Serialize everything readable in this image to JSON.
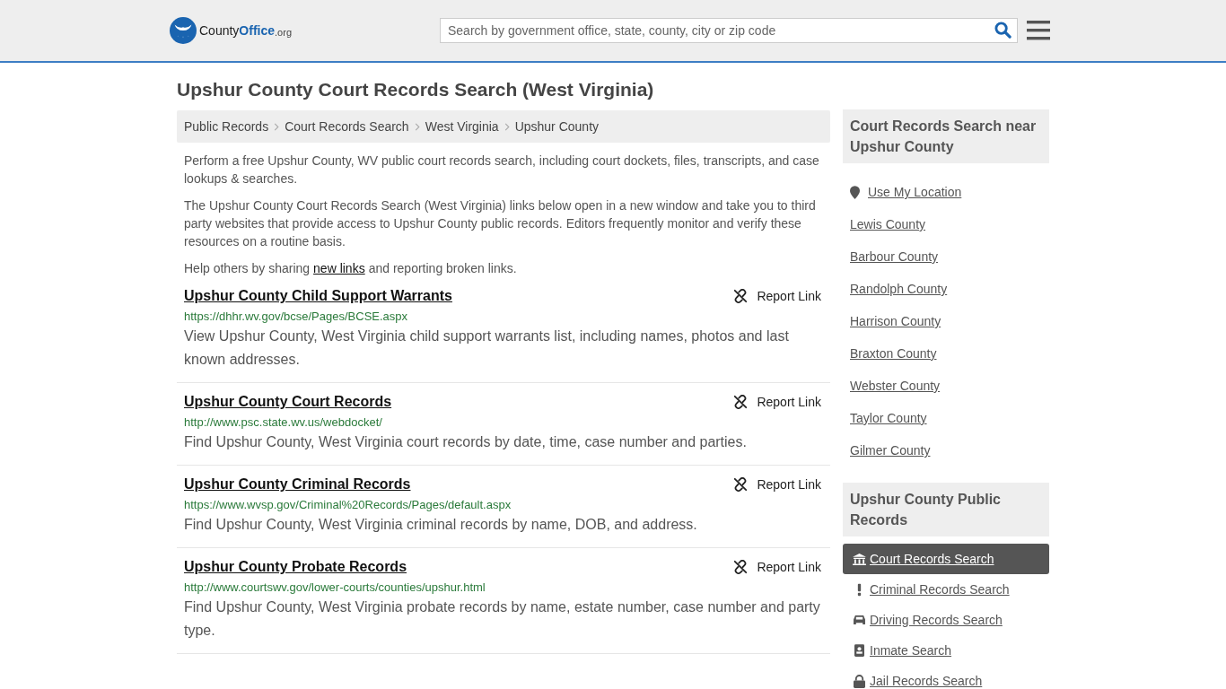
{
  "header": {
    "logo": {
      "name": "County",
      "brand": "Office",
      "suffix": ".org"
    },
    "search": {
      "placeholder": "Search by government office, state, county, city or zip code"
    }
  },
  "page_title": "Upshur County Court Records Search (West Virginia)",
  "breadcrumbs": [
    "Public Records",
    "Court Records Search",
    "West Virginia",
    "Upshur County"
  ],
  "intro": [
    "Perform a free Upshur County, WV public court records search, including court dockets, files, transcripts, and case lookups & searches.",
    "The Upshur County Court Records Search (West Virginia) links below open in a new window and take you to third party websites that provide access to Upshur County public records. Editors frequently monitor and verify these resources on a routine basis."
  ],
  "share_note": {
    "before": "Help others by sharing",
    "link": "new links",
    "after": "and reporting broken links."
  },
  "links": [
    {
      "title": "Upshur County Child Support Warrants",
      "url": "https://dhhr.wv.gov/bcse/Pages/BCSE.aspx",
      "description": "View Upshur County, West Virginia child support warrants list, including names, photos and last known addresses.",
      "report": "Report Link"
    },
    {
      "title": "Upshur County Court Records",
      "url": "http://www.psc.state.wv.us/webdocket/",
      "description": "Find Upshur County, West Virginia court records by date, time, case number and parties.",
      "report": "Report Link"
    },
    {
      "title": "Upshur County Criminal Records",
      "url": "https://www.wvsp.gov/Criminal%20Records/Pages/default.aspx",
      "description": "Find Upshur County, West Virginia criminal records by name, DOB, and address.",
      "report": "Report Link"
    },
    {
      "title": "Upshur County Probate Records",
      "url": "http://www.courtswv.gov/lower-courts/counties/upshur.html",
      "description": "Find Upshur County, West Virginia probate records by name, estate number, case number and party type.",
      "report": "Report Link"
    }
  ],
  "sidebar": {
    "nearby": {
      "heading": "Court Records Search near Upshur County",
      "items": [
        {
          "label": "Use My Location",
          "kind": "location"
        },
        {
          "label": "Lewis County",
          "kind": "plain"
        },
        {
          "label": "Barbour County",
          "kind": "plain"
        },
        {
          "label": "Randolph County",
          "kind": "plain"
        },
        {
          "label": "Harrison County",
          "kind": "plain"
        },
        {
          "label": "Braxton County",
          "kind": "plain"
        },
        {
          "label": "Webster County",
          "kind": "plain"
        },
        {
          "label": "Taylor County",
          "kind": "plain"
        },
        {
          "label": "Gilmer County",
          "kind": "plain"
        }
      ]
    },
    "public_records": {
      "heading": "Upshur County Public Records",
      "items": [
        {
          "label": "Court Records Search",
          "kind": "court",
          "selected": true
        },
        {
          "label": "Criminal Records Search",
          "kind": "criminal",
          "selected": false
        },
        {
          "label": "Driving Records Search",
          "kind": "driving",
          "selected": false
        },
        {
          "label": "Inmate Search",
          "kind": "inmate",
          "selected": false
        },
        {
          "label": "Jail Records Search",
          "kind": "jail",
          "selected": false
        }
      ]
    }
  }
}
